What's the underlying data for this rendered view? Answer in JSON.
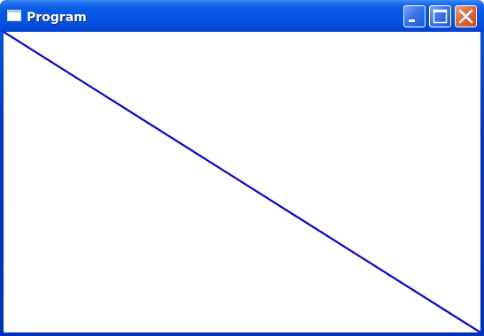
{
  "window": {
    "title": "Program",
    "icon": "window-app-icon"
  },
  "titlebar_buttons": {
    "minimize_icon": "minimize-icon",
    "maximize_icon": "maximize-icon",
    "close_icon": "close-icon"
  },
  "colors": {
    "titlebar": "#0555e4",
    "close_button": "#e06a3c",
    "line": "#0000dd",
    "client_background": "#ffffff"
  }
}
